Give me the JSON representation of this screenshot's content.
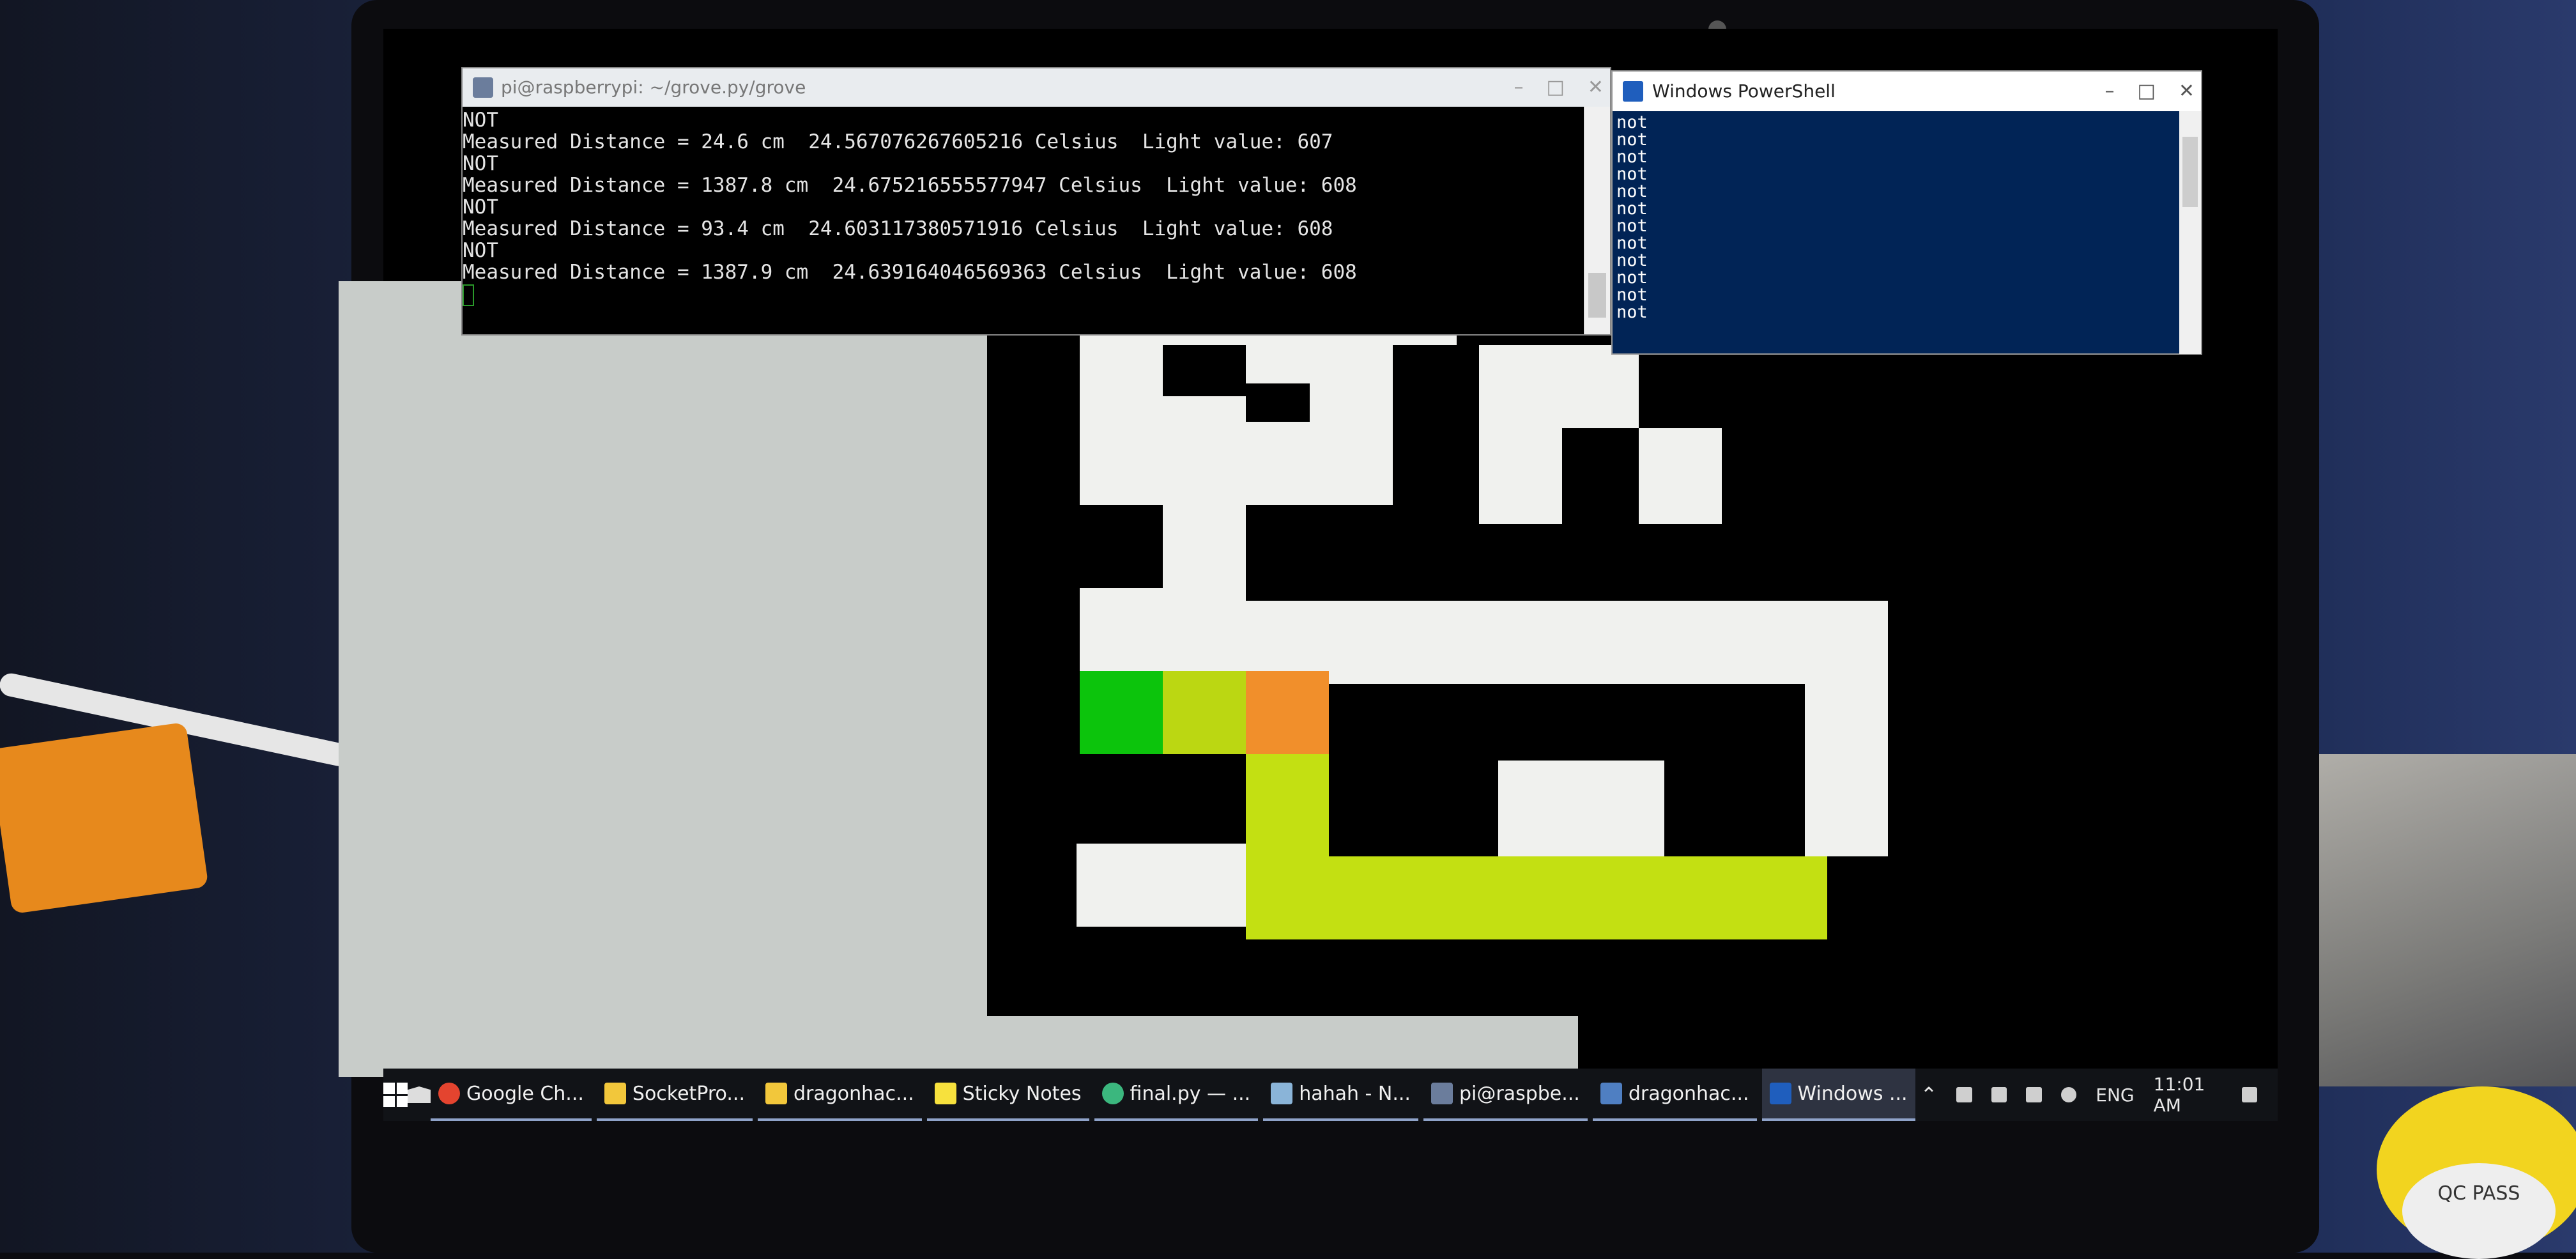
{
  "putty": {
    "title": "pi@raspberrypi: ~/grove.py/grove",
    "lines": [
      "NOT",
      "Measured Distance = 24.6 cm  24.567076267605216 Celsius  Light value: 607",
      "NOT",
      "Measured Distance = 1387.8 cm  24.675216555577947 Celsius  Light value: 608",
      "NOT",
      "Measured Distance = 93.4 cm  24.603117380571916 Celsius  Light value: 608",
      "NOT",
      "Measured Distance = 1387.9 cm  24.639164046569363 Celsius  Light value: 608"
    ]
  },
  "powershell": {
    "title": "Windows PowerShell",
    "lines": [
      "not",
      "not",
      "not",
      "not",
      "not",
      "not",
      "not",
      "not",
      "not",
      "not",
      "not",
      "not"
    ]
  },
  "taskbar": {
    "apps": [
      {
        "label": "Google Ch...",
        "icon": "chrome-icon",
        "color": "#e4442f"
      },
      {
        "label": "SocketPro...",
        "icon": "folder-icon",
        "color": "#f2c73b"
      },
      {
        "label": "dragonhac...",
        "icon": "folder-icon",
        "color": "#f2c73b"
      },
      {
        "label": "Sticky Notes",
        "icon": "sticky-notes-icon",
        "color": "#f7e13d"
      },
      {
        "label": "final.py — ...",
        "icon": "python-icon",
        "color": "#3bb77e"
      },
      {
        "label": "hahah - N...",
        "icon": "notepad-icon",
        "color": "#8ab4d8"
      },
      {
        "label": "pi@raspbe...",
        "icon": "putty-icon",
        "color": "#6b7d9c"
      },
      {
        "label": "dragonhac...",
        "icon": "python-icon",
        "color": "#4f7fc2"
      },
      {
        "label": "Windows ...",
        "icon": "powershell-icon",
        "color": "#1f5ebd"
      }
    ],
    "tray": {
      "language": "ENG",
      "time": "11:01 AM"
    }
  },
  "sticker": {
    "text": "QC PASS"
  },
  "colors": {
    "maze_wall": "#f0f1ee",
    "maze_floor": "#000000",
    "player": "#0cc40c",
    "path": "#bbd712",
    "target": "#f18f2b",
    "powershell_bg": "#012456"
  }
}
